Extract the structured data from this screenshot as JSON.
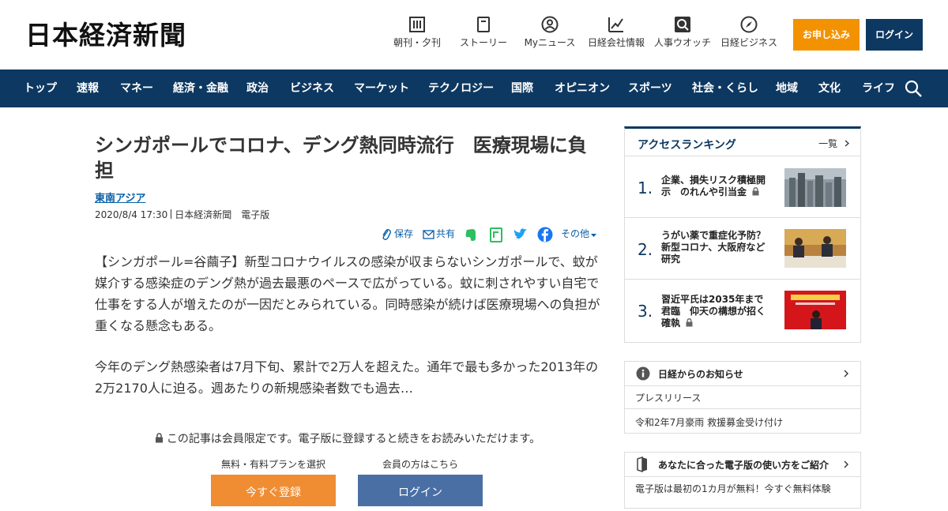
{
  "header": {
    "logo": "日本経済新聞",
    "nav": [
      {
        "icon": "newspaper-icon",
        "label": "朝刊・夕刊"
      },
      {
        "icon": "book-icon",
        "label": "ストーリー"
      },
      {
        "icon": "user-icon",
        "label": "Myニュース"
      },
      {
        "icon": "chart-icon",
        "label": "日経会社情報"
      },
      {
        "icon": "search-person-icon",
        "label": "人事ウオッチ"
      },
      {
        "icon": "compass-icon",
        "label": "日経ビジネス"
      }
    ],
    "apply_label": "お申し込み",
    "login_label": "ログイン"
  },
  "navbar": {
    "items": [
      "トップ",
      "速報",
      "マネー",
      "経済・金融",
      "政治",
      "ビジネス",
      "マーケット",
      "テクノロジー",
      "国際",
      "オピニオン",
      "スポーツ",
      "社会・くらし",
      "地域",
      "文化",
      "ライフ"
    ],
    "search_icon": "search-icon"
  },
  "article": {
    "title": "シンガポールでコロナ、デング熱同時流行　医療現場に負担",
    "category": "東南アジア",
    "date": "2020/8/4 17:30",
    "source": "日本経済新聞　電子版",
    "actions": {
      "save": "保存",
      "share": "共有",
      "more": "その他"
    },
    "paragraphs": [
      "【シンガポール=谷繭子】新型コロナウイルスの感染が収まらないシンガポールで、蚊が媒介する感染症のデング熱が過去最悪のペースで広がっている。蚊に刺されやすい自宅で仕事をする人が増えたのが一因だとみられている。同時感染が続けば医療現場への負担が重くなる懸念もある。",
      "今年のデング熱感染者は7月下旬、累計で2万人を超えた。通年で最も多かった2013年の2万2170人に迫る。週あたりの新規感染者数でも過去…"
    ],
    "member_note": "この記事は会員限定です。電子版に登録すると続きをお読みいただけます。",
    "plan_caption": "無料・有料プランを選択",
    "member_caption": "会員の方はこちら",
    "register_label": "今すぐ登録",
    "login_label": "ログイン"
  },
  "ranking": {
    "title": "アクセスランキング",
    "more": "一覧",
    "items": [
      {
        "rank": "1.",
        "title": "企業、損失リスク積極開示　のれんや引当金"
      },
      {
        "rank": "2.",
        "title": "うがい薬で重症化予防？　新型コロナ、大阪府など研究"
      },
      {
        "rank": "3.",
        "title": "習近平氏は2035年まで君臨　仰天の構想が招く確執"
      }
    ]
  },
  "notices": {
    "title": "日経からのお知らせ",
    "items": [
      "プレスリリース",
      "令和2年7月豪雨 救援募金受け付け"
    ]
  },
  "guide": {
    "title": "あなたに合った電子版の使い方をご紹介",
    "items": [
      "電子版は最初の1カ月が無料！今すぐ無料体験"
    ]
  },
  "colors": {
    "navy": "#0d3861",
    "orange": "#f39200",
    "link_blue": "#0a5fa8"
  }
}
